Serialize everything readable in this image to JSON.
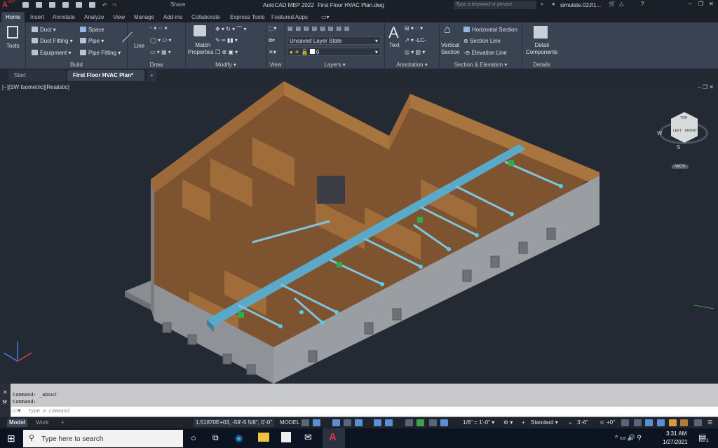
{
  "app": {
    "logo": "A",
    "logo_sub": "MEP",
    "title": "AutoCAD MEP 2022",
    "file": "First Floor HVAC Plan.dwg",
    "share": "Share",
    "search_placeholder": "Type a keyword or phrase",
    "user": "simulate.02JI1..."
  },
  "ribbon_tabs": [
    "Home",
    "Insert",
    "Annotate",
    "Analyze",
    "View",
    "Manage",
    "Add-ins",
    "Collaborate",
    "Express Tools",
    "Featured Apps"
  ],
  "active_tab": "Home",
  "ribbon": {
    "tools": "Tools",
    "build": {
      "label": "Build",
      "items": [
        "Duct",
        "Duct Fitting",
        "Equipment",
        "Space",
        "Pipe",
        "Pipe Fitting"
      ]
    },
    "draw": {
      "label": "Draw",
      "line": "Line"
    },
    "modify": {
      "label": "Modify",
      "match": "Match",
      "properties": "Properties"
    },
    "view": {
      "label": "View"
    },
    "layers": {
      "label": "Layers",
      "layer_state": "Unsaved Layer State",
      "layer": "0"
    },
    "annotation": {
      "label": "Annotation",
      "text": "Text"
    },
    "section": {
      "label": "Section & Elevation",
      "vertical": "Vertical",
      "section": "Section",
      "items": [
        "Horizontal Section",
        "Section Line",
        "Elevation Line"
      ]
    },
    "details": {
      "label": "Details",
      "detail": "Detail",
      "components": "Components"
    }
  },
  "doc_tabs": [
    {
      "label": "Start"
    },
    {
      "label": "First Floor HVAC Plan*"
    }
  ],
  "viewport": {
    "label": "[−][SW Isometric][Realistic]",
    "viewcube": {
      "top": "TOP",
      "left": "LEFT",
      "front": "FRONT",
      "compass_w": "W",
      "compass_s": "S"
    },
    "wcs": "WCS"
  },
  "command": {
    "history": [
      "Command:  _about",
      "Command:"
    ],
    "placeholder": "Type a command"
  },
  "layout_tabs": [
    "Model",
    "Work"
  ],
  "status": {
    "coords": "1.51870E+03, -59'-5 5/8\", 0'-0\"",
    "space": "MODEL",
    "scale": "1/8\" = 1'-0\"",
    "style": "Standard",
    "elevation": "3'-6\"",
    "offset": "+0\""
  },
  "taskbar": {
    "search_placeholder": "Type here to search",
    "time": "3:31 AM",
    "date": "1/27/2021",
    "notifications": "1"
  },
  "colors": {
    "accent": "#5b8fd1",
    "ribbon": "#3a4352",
    "viewport": "#232a33",
    "duct": "#5aa9c9",
    "floor": "#8a5a2e",
    "wall": "#8f9296"
  }
}
